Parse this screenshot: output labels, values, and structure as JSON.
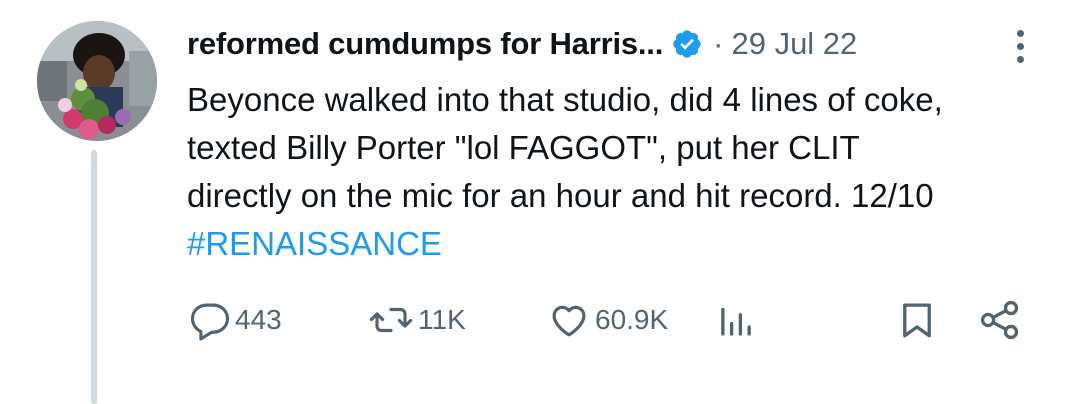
{
  "tweet": {
    "display_name": "reformed cumdumps for Harris...",
    "separator": "·",
    "date": "29 Jul 22",
    "text_lines": [
      "Beyonce walked into that studio, did 4 lines of coke,",
      "texted Billy Porter \"lol FAGGOT\", put her CLIT",
      "directly on the mic for an hour and hit record. 12/10"
    ],
    "hashtag": "#RENAISSANCE"
  },
  "actions": {
    "reply_count": "443",
    "retweet_count": "11K",
    "like_count": "60.9K"
  },
  "icons": {
    "verified": "verified-badge-icon",
    "more": "more-options-icon",
    "reply": "reply-icon",
    "retweet": "retweet-icon",
    "like": "heart-icon",
    "views": "views-icon",
    "bookmark": "bookmark-icon",
    "share": "share-icon"
  },
  "colors": {
    "verified_blue": "#1d9bf0",
    "hashtag_blue": "#1d9bf0",
    "secondary_text": "#536471",
    "thread_line": "#cfd9de"
  }
}
